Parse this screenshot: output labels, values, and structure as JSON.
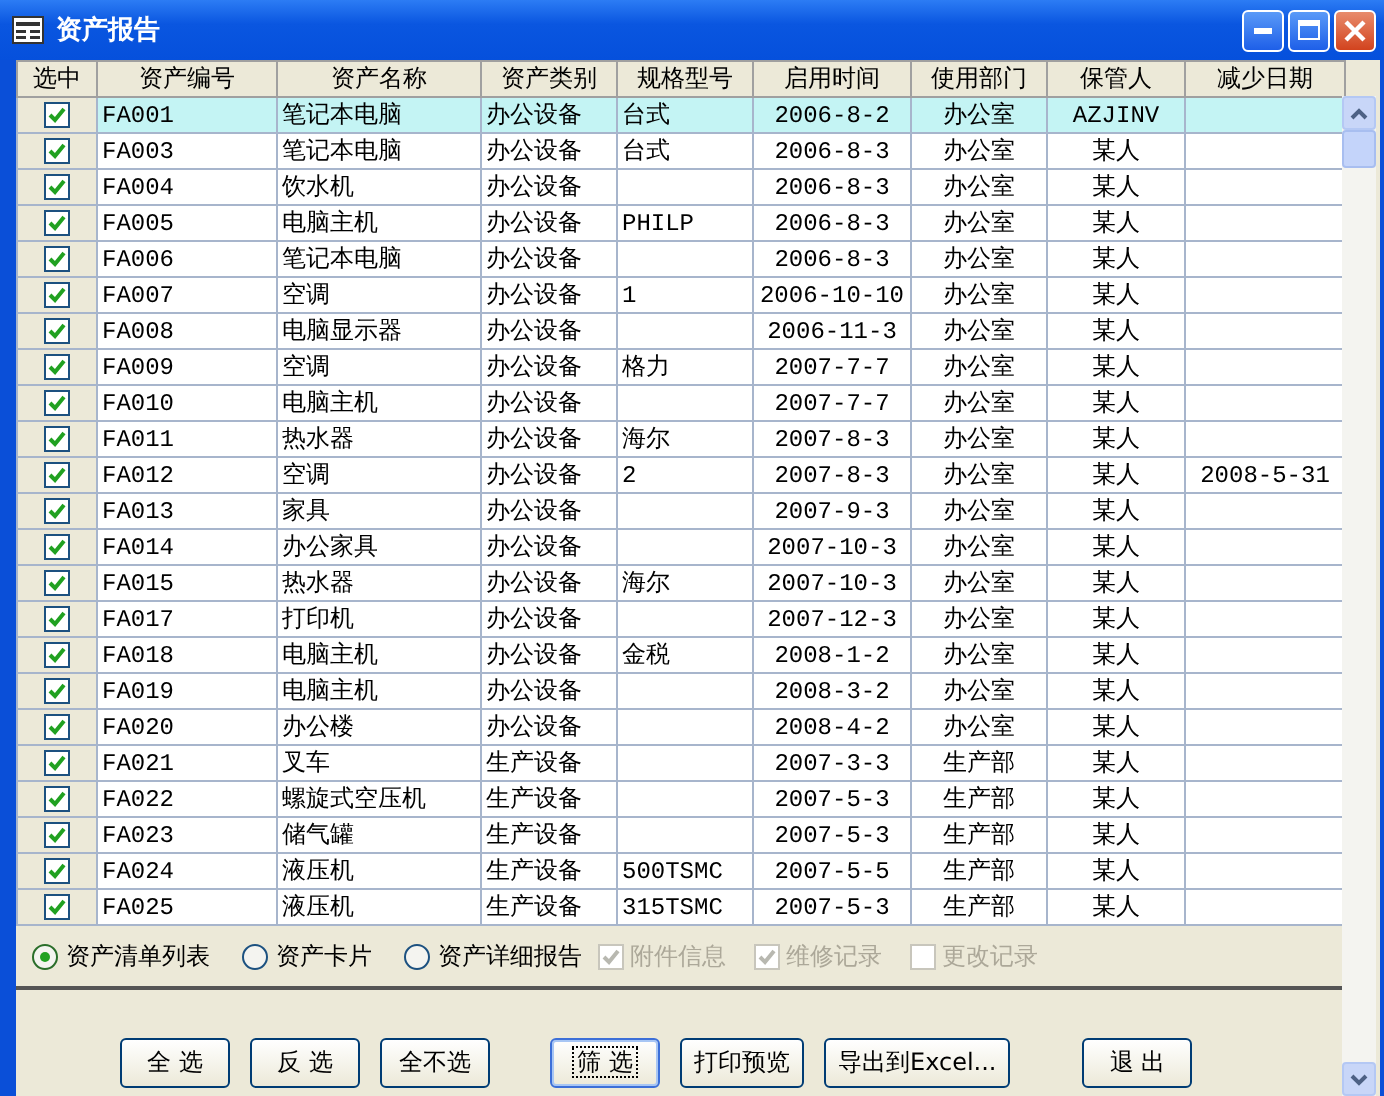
{
  "window": {
    "title": "资产报告"
  },
  "table": {
    "check_header": "选中",
    "columns": [
      "资产编号",
      "资产名称",
      "资产类别",
      "规格型号",
      "启用时间",
      "使用部门",
      "保管人",
      "减少日期"
    ],
    "rows": [
      {
        "selected": true,
        "checked": true,
        "cells": [
          "FA001",
          "笔记本电脑",
          "办公设备",
          "台式",
          "2006-8-2",
          "办公室",
          "AZJINV",
          ""
        ]
      },
      {
        "selected": false,
        "checked": true,
        "cells": [
          "FA003",
          "笔记本电脑",
          "办公设备",
          "台式",
          "2006-8-3",
          "办公室",
          "某人",
          ""
        ]
      },
      {
        "selected": false,
        "checked": true,
        "cells": [
          "FA004",
          "饮水机",
          "办公设备",
          "",
          "2006-8-3",
          "办公室",
          "某人",
          ""
        ]
      },
      {
        "selected": false,
        "checked": true,
        "cells": [
          "FA005",
          "电脑主机",
          "办公设备",
          "PHILP",
          "2006-8-3",
          "办公室",
          "某人",
          ""
        ]
      },
      {
        "selected": false,
        "checked": true,
        "cells": [
          "FA006",
          "笔记本电脑",
          "办公设备",
          "",
          "2006-8-3",
          "办公室",
          "某人",
          ""
        ]
      },
      {
        "selected": false,
        "checked": true,
        "cells": [
          "FA007",
          "空调",
          "办公设备",
          "1",
          "2006-10-10",
          "办公室",
          "某人",
          ""
        ]
      },
      {
        "selected": false,
        "checked": true,
        "cells": [
          "FA008",
          "电脑显示器",
          "办公设备",
          "",
          "2006-11-3",
          "办公室",
          "某人",
          ""
        ]
      },
      {
        "selected": false,
        "checked": true,
        "cells": [
          "FA009",
          "空调",
          "办公设备",
          "格力",
          "2007-7-7",
          "办公室",
          "某人",
          ""
        ]
      },
      {
        "selected": false,
        "checked": true,
        "cells": [
          "FA010",
          "电脑主机",
          "办公设备",
          "",
          "2007-7-7",
          "办公室",
          "某人",
          ""
        ]
      },
      {
        "selected": false,
        "checked": true,
        "cells": [
          "FA011",
          "热水器",
          "办公设备",
          "海尔",
          "2007-8-3",
          "办公室",
          "某人",
          ""
        ]
      },
      {
        "selected": false,
        "checked": true,
        "cells": [
          "FA012",
          "空调",
          "办公设备",
          "2",
          "2007-8-3",
          "办公室",
          "某人",
          "2008-5-31"
        ]
      },
      {
        "selected": false,
        "checked": true,
        "cells": [
          "FA013",
          "家具",
          "办公设备",
          "",
          "2007-9-3",
          "办公室",
          "某人",
          ""
        ]
      },
      {
        "selected": false,
        "checked": true,
        "cells": [
          "FA014",
          "办公家具",
          "办公设备",
          "",
          "2007-10-3",
          "办公室",
          "某人",
          ""
        ]
      },
      {
        "selected": false,
        "checked": true,
        "cells": [
          "FA015",
          "热水器",
          "办公设备",
          "海尔",
          "2007-10-3",
          "办公室",
          "某人",
          ""
        ]
      },
      {
        "selected": false,
        "checked": true,
        "cells": [
          "FA017",
          "打印机",
          "办公设备",
          "",
          "2007-12-3",
          "办公室",
          "某人",
          ""
        ]
      },
      {
        "selected": false,
        "checked": true,
        "cells": [
          "FA018",
          "电脑主机",
          "办公设备",
          "金税",
          "2008-1-2",
          "办公室",
          "某人",
          ""
        ]
      },
      {
        "selected": false,
        "checked": true,
        "cells": [
          "FA019",
          "电脑主机",
          "办公设备",
          "",
          "2008-3-2",
          "办公室",
          "某人",
          ""
        ]
      },
      {
        "selected": false,
        "checked": true,
        "cells": [
          "FA020",
          "办公楼",
          "办公设备",
          "",
          "2008-4-2",
          "办公室",
          "某人",
          ""
        ]
      },
      {
        "selected": false,
        "checked": true,
        "cells": [
          "FA021",
          "叉车",
          "生产设备",
          "",
          "2007-3-3",
          "生产部",
          "某人",
          ""
        ]
      },
      {
        "selected": false,
        "checked": true,
        "cells": [
          "FA022",
          "螺旋式空压机",
          "生产设备",
          "",
          "2007-5-3",
          "生产部",
          "某人",
          ""
        ]
      },
      {
        "selected": false,
        "checked": true,
        "cells": [
          "FA023",
          "储气罐",
          "生产设备",
          "",
          "2007-5-3",
          "生产部",
          "某人",
          ""
        ]
      },
      {
        "selected": false,
        "checked": true,
        "cells": [
          "FA024",
          "液压机",
          "生产设备",
          "500TSMC",
          "2007-5-5",
          "生产部",
          "某人",
          ""
        ]
      },
      {
        "selected": false,
        "checked": true,
        "cells": [
          "FA025",
          "液压机",
          "生产设备",
          "315TSMC",
          "2007-5-3",
          "生产部",
          "某人",
          ""
        ]
      }
    ]
  },
  "report_types": [
    {
      "label": "资产清单列表",
      "selected": true
    },
    {
      "label": "资产卡片",
      "selected": false
    },
    {
      "label": "资产详细报告",
      "selected": false
    }
  ],
  "options": [
    {
      "label": "附件信息",
      "checked": true,
      "disabled": true
    },
    {
      "label": "维修记录",
      "checked": true,
      "disabled": true
    },
    {
      "label": "更改记录",
      "checked": false,
      "disabled": true
    }
  ],
  "buttons": [
    {
      "label": "全 选",
      "focused": false
    },
    {
      "label": "反 选",
      "focused": false
    },
    {
      "label": "全不选",
      "focused": false
    },
    {
      "label": "筛 选",
      "focused": true
    },
    {
      "label": "打印预览",
      "focused": false
    },
    {
      "label": "导出到Excel...",
      "focused": false
    },
    {
      "label": "退 出",
      "focused": false
    }
  ]
}
